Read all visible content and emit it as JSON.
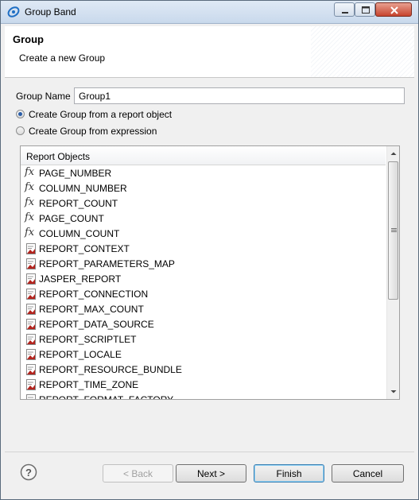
{
  "window": {
    "title": "Group Band"
  },
  "header": {
    "title": "Group",
    "subtitle": "Create a new Group"
  },
  "form": {
    "group_name_label": "Group Name",
    "group_name_value": "Group1",
    "radio_report_object": {
      "label": "Create Group from a report object",
      "checked": true
    },
    "radio_expression": {
      "label": "Create Group from expression",
      "checked": false
    }
  },
  "report_objects": {
    "column_header": "Report Objects",
    "items": [
      {
        "label": "PAGE_NUMBER",
        "icon": "fx-icon"
      },
      {
        "label": "COLUMN_NUMBER",
        "icon": "fx-icon"
      },
      {
        "label": "REPORT_COUNT",
        "icon": "fx-icon"
      },
      {
        "label": "PAGE_COUNT",
        "icon": "fx-icon"
      },
      {
        "label": "COLUMN_COUNT",
        "icon": "fx-icon"
      },
      {
        "label": "REPORT_CONTEXT",
        "icon": "parameter-icon"
      },
      {
        "label": "REPORT_PARAMETERS_MAP",
        "icon": "parameter-icon"
      },
      {
        "label": "JASPER_REPORT",
        "icon": "parameter-icon"
      },
      {
        "label": "REPORT_CONNECTION",
        "icon": "parameter-icon"
      },
      {
        "label": "REPORT_MAX_COUNT",
        "icon": "parameter-icon"
      },
      {
        "label": "REPORT_DATA_SOURCE",
        "icon": "parameter-icon"
      },
      {
        "label": "REPORT_SCRIPTLET",
        "icon": "parameter-icon"
      },
      {
        "label": "REPORT_LOCALE",
        "icon": "parameter-icon"
      },
      {
        "label": "REPORT_RESOURCE_BUNDLE",
        "icon": "parameter-icon"
      },
      {
        "label": "REPORT_TIME_ZONE",
        "icon": "parameter-icon"
      },
      {
        "label": "REPORT_FORMAT_FACTORY",
        "icon": "parameter-icon"
      }
    ]
  },
  "buttons": {
    "back": "< Back",
    "next": "Next >",
    "finish": "Finish",
    "cancel": "Cancel"
  }
}
